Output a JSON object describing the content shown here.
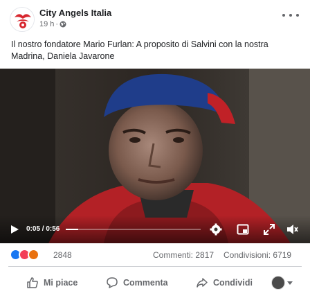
{
  "post": {
    "page_name": "City Angels Italia",
    "time": "19 h",
    "separator": "·",
    "text": "Il nostro fondatore Mario Furlan: A proposito di Salvini con la nostra Madrina, Daniela Javarone",
    "audience_icon": "globe-icon"
  },
  "video": {
    "time_readout": "0:05 / 0:56",
    "progress_fraction": 0.09,
    "icons": [
      "play-icon",
      "settings-icon",
      "picture-in-picture-icon",
      "fullscreen-icon",
      "volume-icon"
    ]
  },
  "stats": {
    "reaction_count": "2848",
    "comments": "Commenti: 2817",
    "shares": "Condivisioni: 6719",
    "reaction_colors": {
      "like": "#1877f2",
      "love": "#f33e58",
      "angry": "#e9710f"
    }
  },
  "actions": {
    "like": "Mi piace",
    "comment": "Commenta",
    "share": "Condividi"
  }
}
